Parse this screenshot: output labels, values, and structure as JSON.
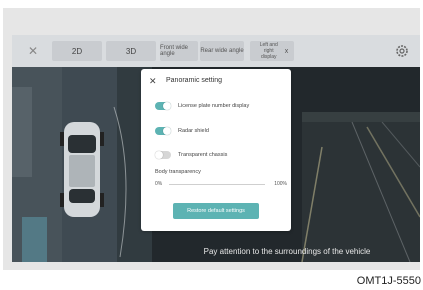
{
  "topbar": {
    "btn_2d": "2D",
    "btn_3d": "3D",
    "btn_front_wide": "Front wide angle",
    "btn_rear_wide": "Rear wide angle",
    "btn_left_right": "Left and right display",
    "btn_left_right_close": "x"
  },
  "panel": {
    "title": "Panoramic setting",
    "license_plate_label": "License plate number display",
    "license_plate_on": true,
    "radar_label": "Radar shield",
    "radar_on": true,
    "chassis_label": "Transparent chassis",
    "chassis_on": false,
    "body_transparency_label": "Body transparency",
    "slider_min": "0%",
    "slider_max": "100%",
    "restore_label": "Restore default settings"
  },
  "caption": "Pay attention to the surroundings of the vehicle",
  "watermark": "OMT1J-5550",
  "colors": {
    "accent": "#5db3b3",
    "topbar": "#d9dcdf"
  }
}
